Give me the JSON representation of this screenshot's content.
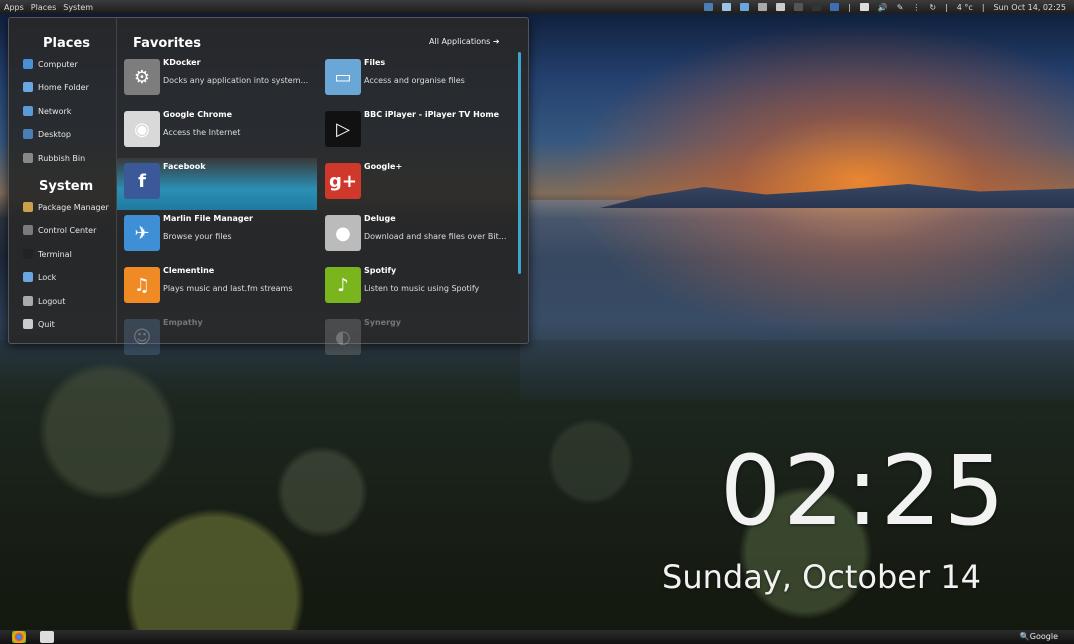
{
  "top_panel": {
    "menus": [
      "Apps",
      "Places",
      "System"
    ],
    "weather": "4 °c",
    "datetime": "Sun Oct 14, 02:25",
    "separator": "|"
  },
  "menu": {
    "places_title": "Places",
    "places": [
      {
        "label": "Computer",
        "icon": "computer-icon",
        "color": "#4a90d9"
      },
      {
        "label": "Home Folder",
        "icon": "home-folder-icon",
        "color": "#6aa6e0"
      },
      {
        "label": "Network",
        "icon": "network-icon",
        "color": "#5b9bd5"
      },
      {
        "label": "Desktop",
        "icon": "desktop-icon",
        "color": "#4a7fb5"
      },
      {
        "label": "Rubbish Bin",
        "icon": "trash-icon",
        "color": "#888888"
      }
    ],
    "system_title": "System",
    "system": [
      {
        "label": "Package Manager",
        "icon": "package-icon",
        "color": "#c9a04b"
      },
      {
        "label": "Control Center",
        "icon": "control-center-icon",
        "color": "#7a7a7a"
      },
      {
        "label": "Terminal",
        "icon": "terminal-icon",
        "color": "#222222"
      },
      {
        "label": "Lock",
        "icon": "lock-icon",
        "color": "#6aa6e0"
      },
      {
        "label": "Logout",
        "icon": "logout-icon",
        "color": "#aaaaaa"
      },
      {
        "label": "Quit",
        "icon": "power-icon",
        "color": "#cccccc"
      }
    ],
    "favorites_title": "Favorites",
    "all_apps": "All Applications ➜",
    "apps": [
      {
        "name": "KDocker",
        "desc": "Docks any application into system...",
        "icon": "gear-icon",
        "color": "#7d7d7d",
        "glyph": "⚙"
      },
      {
        "name": "Files",
        "desc": "Access and organise files",
        "icon": "folder-icon",
        "color": "#6aa6d6",
        "glyph": "▭"
      },
      {
        "name": "Google Chrome",
        "desc": "Access the Internet",
        "icon": "chrome-icon",
        "color": "#d9d9d9",
        "glyph": "◉"
      },
      {
        "name": "BBC iPlayer - iPlayer TV Home",
        "desc": "",
        "icon": "iplayer-icon",
        "color": "#111111",
        "glyph": "▷"
      },
      {
        "name": "Facebook",
        "desc": "",
        "icon": "facebook-icon",
        "color": "#3b5998",
        "glyph": "f"
      },
      {
        "name": "Google+",
        "desc": "",
        "icon": "google-plus-icon",
        "color": "#d0382b",
        "glyph": "g+"
      },
      {
        "name": "Marlin File Manager",
        "desc": "Browse your files",
        "icon": "marlin-icon",
        "color": "#3f8fd6",
        "glyph": "✈"
      },
      {
        "name": "Deluge",
        "desc": "Download and share files over Bit...",
        "icon": "deluge-icon",
        "color": "#bbbbbb",
        "glyph": "●"
      },
      {
        "name": "Clementine",
        "desc": "Plays music and last.fm streams",
        "icon": "clementine-icon",
        "color": "#f08a24",
        "glyph": "♫"
      },
      {
        "name": "Spotify",
        "desc": "Listen to music using Spotify",
        "icon": "spotify-icon",
        "color": "#7ab51d",
        "glyph": "♪"
      },
      {
        "name": "Empathy",
        "desc": "",
        "icon": "empathy-icon",
        "color": "#5a7aa0",
        "glyph": "☺"
      },
      {
        "name": "Synergy",
        "desc": "",
        "icon": "synergy-icon",
        "color": "#888888",
        "glyph": "◐"
      }
    ]
  },
  "clock": {
    "time": "02:25",
    "date": "Sunday, October 14"
  },
  "bottom_panel": {
    "search": "🔍Google"
  }
}
